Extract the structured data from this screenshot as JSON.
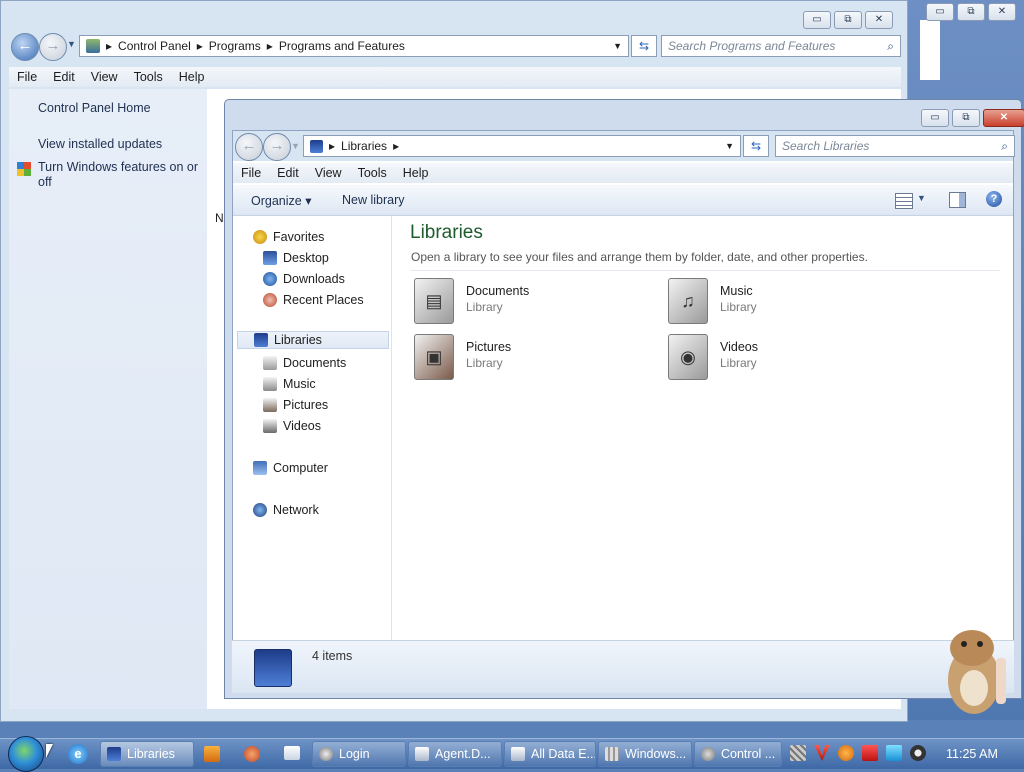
{
  "control_panel": {
    "breadcrumb": [
      "Control Panel",
      "Programs",
      "Programs and Features"
    ],
    "search_placeholder": "Search Programs and Features",
    "menu": [
      "File",
      "Edit",
      "View",
      "Tools",
      "Help"
    ],
    "links": {
      "home": "Control Panel Home",
      "updates": "View installed updates",
      "features": "Turn Windows features on or off"
    },
    "column_header_fragment": "N"
  },
  "window_controls": {
    "minimize": "▭",
    "maximize": "⧉",
    "close": "✕"
  },
  "libraries_window": {
    "breadcrumb": [
      "Libraries"
    ],
    "search_placeholder": "Search Libraries",
    "menu": [
      "File",
      "Edit",
      "View",
      "Tools",
      "Help"
    ],
    "commands": {
      "organize": "Organize ▾",
      "new_library": "New library",
      "help": "?"
    },
    "tree": {
      "favorites": "Favorites",
      "desktop": "Desktop",
      "downloads": "Downloads",
      "recent": "Recent Places",
      "libraries": "Libraries",
      "documents": "Documents",
      "music": "Music",
      "pictures": "Pictures",
      "videos": "Videos",
      "computer": "Computer",
      "network": "Network"
    },
    "content": {
      "title": "Libraries",
      "description": "Open a library to see your files and arrange them by folder, date, and other properties.",
      "items": [
        {
          "name": "Documents",
          "type": "Library"
        },
        {
          "name": "Music",
          "type": "Library"
        },
        {
          "name": "Pictures",
          "type": "Library"
        },
        {
          "name": "Videos",
          "type": "Library"
        }
      ]
    },
    "status": "4 items"
  },
  "taskbar": {
    "buttons": [
      "Libraries",
      "Login",
      "Agent.D...",
      "All Data E...",
      "Windows...",
      "Control ..."
    ],
    "clock": "11:25 AM"
  },
  "colors": {
    "library_title": "#1e5c2e",
    "taskbar": "#3e69a6"
  }
}
